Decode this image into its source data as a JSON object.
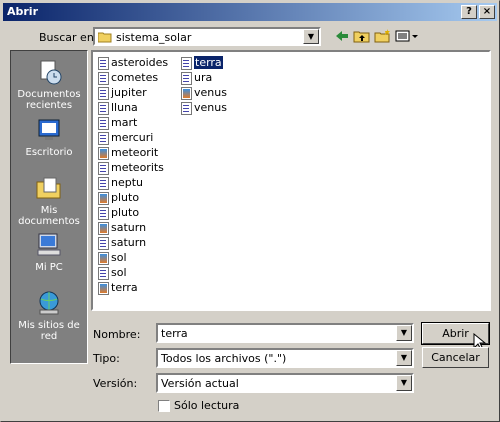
{
  "window": {
    "title": "Abrir",
    "help_label": "?",
    "close_label": "×"
  },
  "lookin": {
    "label": "Buscar en:",
    "value": "sistema_solar"
  },
  "places": [
    {
      "label1": "Documentos",
      "label2": "recientes"
    },
    {
      "label1": "Escritorio"
    },
    {
      "label1": "Mis documentos"
    },
    {
      "label1": "Mi PC"
    },
    {
      "label1": "Mis sitios de red"
    }
  ],
  "files": [
    {
      "name": "asteroides",
      "type": "doc"
    },
    {
      "name": "cometes",
      "type": "doc"
    },
    {
      "name": "jupiter",
      "type": "doc"
    },
    {
      "name": "lluna",
      "type": "doc"
    },
    {
      "name": "mart",
      "type": "doc"
    },
    {
      "name": "mercuri",
      "type": "doc"
    },
    {
      "name": "meteorit",
      "type": "img"
    },
    {
      "name": "meteorits",
      "type": "doc"
    },
    {
      "name": "neptu",
      "type": "doc"
    },
    {
      "name": "pluto",
      "type": "img"
    },
    {
      "name": "pluto",
      "type": "doc"
    },
    {
      "name": "saturn",
      "type": "img"
    },
    {
      "name": "saturn",
      "type": "doc"
    },
    {
      "name": "sol",
      "type": "img"
    },
    {
      "name": "sol",
      "type": "doc"
    },
    {
      "name": "terra",
      "type": "img"
    },
    {
      "name": "terra",
      "type": "doc",
      "selected": true
    },
    {
      "name": "ura",
      "type": "doc"
    },
    {
      "name": "venus",
      "type": "img"
    },
    {
      "name": "venus",
      "type": "doc"
    }
  ],
  "filename": {
    "label": "Nombre:",
    "value": "terra"
  },
  "filetype": {
    "label": "Tipo:",
    "value": "Todos los archivos (\".\")"
  },
  "version": {
    "label": "Versión:",
    "value": "Versión actual"
  },
  "readonly": {
    "label": "Sólo lectura",
    "checked": false
  },
  "buttons": {
    "open": "Abrir",
    "cancel": "Cancelar"
  }
}
